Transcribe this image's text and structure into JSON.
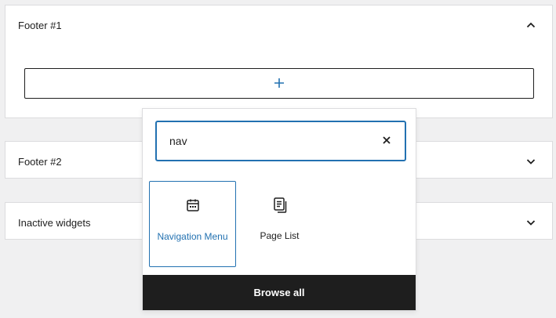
{
  "widget_areas": [
    {
      "title": "Footer #1",
      "expanded": true,
      "chevron": "chevron-up-icon"
    },
    {
      "title": "Footer #2",
      "expanded": false,
      "chevron": "chevron-down-icon"
    },
    {
      "title": "Inactive widgets",
      "expanded": false,
      "chevron": "chevron-down-icon"
    }
  ],
  "appender": {
    "icon": "plus-icon"
  },
  "inserter": {
    "search_value": "nav",
    "clear_icon": "close-icon",
    "blocks": [
      {
        "label": "Navigation Menu",
        "icon": "calendar-icon",
        "selected": true
      },
      {
        "label": "Page List",
        "icon": "pages-icon",
        "selected": false
      }
    ],
    "browse_all_label": "Browse all"
  },
  "colors": {
    "accent": "#2271b1",
    "dark": "#1e1e1e",
    "background": "#f0f0f1"
  }
}
